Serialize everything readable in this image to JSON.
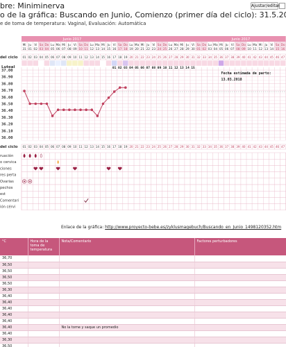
{
  "header": {
    "name_line": "bre: Miniminerva",
    "chart_line": "o de la gráfica: Buscando en Junio, Comienzo (primer día del ciclo): 31.5.2017",
    "method_line": "e de toma de temperatura: Vaginal, Evaluación: Automática",
    "adjust_button": "Ajustar/editar"
  },
  "calendar": {
    "months": [
      "Junio 2017",
      "Junio 2017"
    ],
    "weekdays": [
      "Mi",
      "Ju",
      "Vi",
      "Sa",
      "Do",
      "Lu",
      "Ma",
      "Mi",
      "Ju",
      "Vi",
      "Sa",
      "Do",
      "Lu",
      "Ma",
      "Mi",
      "Ju",
      "Vi",
      "Sa",
      "Do",
      "Lu",
      "Ma",
      "Mi",
      "Ju",
      "Vi",
      "Sa",
      "Do",
      "Lu",
      "Ma",
      "Mi",
      "Ju",
      "Vi",
      "Sa",
      "Do",
      "Lu",
      "Ma",
      "Mi",
      "Ju",
      "Vi",
      "Sa",
      "Do",
      "Lu",
      "Ma",
      "Mi",
      "Ju",
      "Vi",
      "Sa",
      "Do"
    ],
    "dates": [
      "31",
      "01",
      "02",
      "03",
      "04",
      "05",
      "06",
      "07",
      "08",
      "09",
      "10",
      "11",
      "12",
      "13",
      "14",
      "15",
      "16",
      "17",
      "18",
      "19",
      "20",
      "21",
      "22",
      "23",
      "24",
      "25",
      "26",
      "27",
      "28",
      "29",
      "30",
      "01",
      "02",
      "03",
      "04",
      "05",
      "06",
      "07",
      "08",
      "09",
      "10",
      "11",
      "12",
      "13",
      "14",
      "15",
      "16"
    ],
    "day_label": "del ciclo",
    "cycle_days": [
      "01",
      "02",
      "03",
      "04",
      "05",
      "06",
      "07",
      "08",
      "09",
      "10",
      "11",
      "12",
      "13",
      "14",
      "15",
      "16",
      "17",
      "18",
      "19",
      "20",
      "21",
      "22",
      "23",
      "24",
      "25",
      "26",
      "27",
      "28",
      "29",
      "30",
      "31",
      "32",
      "33",
      "34",
      "35",
      "36",
      "37",
      "38",
      "39",
      "40",
      "41",
      "42",
      "43",
      "44",
      "45",
      "46",
      "47"
    ]
  },
  "luteal": {
    "label": "Luteal",
    "days": [
      "01",
      "02",
      "03",
      "04",
      "05",
      "06",
      "07",
      "08",
      "09",
      "10",
      "11",
      "12",
      "13",
      "14",
      "15"
    ]
  },
  "due_date": {
    "label": "Fecha estimada de parto:",
    "value": "13.03.2018"
  },
  "temp_axis": [
    "37.00",
    "36.90",
    "36.80",
    "36.70",
    "36.60",
    "36.50",
    "36.40",
    "36.30",
    "36.20",
    "36.10",
    "36.00"
  ],
  "chart_data": {
    "type": "line",
    "x": [
      1,
      2,
      3,
      4,
      5,
      6,
      7,
      8,
      9,
      10,
      11,
      12,
      13,
      14,
      15,
      16,
      17,
      18,
      19
    ],
    "values": [
      36.69,
      36.5,
      36.5,
      36.5,
      36.5,
      36.32,
      36.41,
      36.41,
      36.41,
      36.41,
      36.41,
      36.41,
      36.41,
      36.32,
      36.5,
      36.59,
      36.68,
      36.74,
      36.74
    ],
    "ylim": [
      36.0,
      37.05
    ],
    "grid": true
  },
  "rows": {
    "labels": [
      "ruación",
      "o cervica",
      "ciones",
      "res perta",
      "Ovarias",
      "pechos",
      "est",
      "Comentari",
      "ión cérvi"
    ],
    "menstruation_days": [
      1,
      2,
      3,
      4
    ],
    "cervical_days": [
      7,
      16
    ],
    "intercourse_days": [
      3,
      4,
      7,
      10,
      16,
      18
    ],
    "ovary_days": [
      1,
      2
    ],
    "comment_days": [
      12
    ]
  },
  "link": {
    "label": "Enlace de la gráfica:",
    "url": "http://www.proyecto-bebe.es/zyklusmagebuch/Buscando_en_Junio_1498120352.htm"
  },
  "table": {
    "headers": [
      "°C",
      "Hora de la toma de temperatura",
      "Nota/Comentario",
      "Factores perturbadores"
    ],
    "rows": [
      {
        "temp": "36,70",
        "note": ""
      },
      {
        "temp": "36,50",
        "note": ""
      },
      {
        "temp": "36,50",
        "note": ""
      },
      {
        "temp": "36,50",
        "note": ""
      },
      {
        "temp": "36,50",
        "note": ""
      },
      {
        "temp": "36,30",
        "note": ""
      },
      {
        "temp": "36,40",
        "note": ""
      },
      {
        "temp": "36,40",
        "note": ""
      },
      {
        "temp": "36,40",
        "note": ""
      },
      {
        "temp": "36,40",
        "note": ""
      },
      {
        "temp": "36,40",
        "note": ""
      },
      {
        "temp": "36,40",
        "note": "No la tome y saque un promedio"
      },
      {
        "temp": "36,40",
        "note": ""
      },
      {
        "temp": "36,30",
        "note": ""
      },
      {
        "temp": "36,50",
        "note": ""
      },
      {
        "temp": "36,50",
        "note": ""
      }
    ]
  },
  "colors": {
    "grid": "#e8b8c8",
    "header_bg": "#e891b0",
    "accent": "#c6577c",
    "line": "#c0415f",
    "heart": "#9a2044",
    "pale": "#f9e6ed"
  }
}
